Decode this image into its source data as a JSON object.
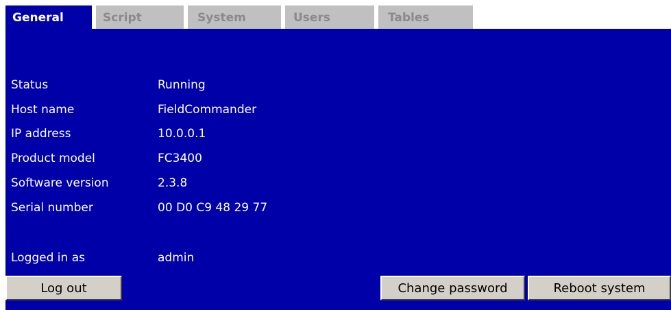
{
  "tabs": [
    {
      "label": "General",
      "active": true
    },
    {
      "label": "Script",
      "active": false
    },
    {
      "label": "System",
      "active": false
    },
    {
      "label": "Users",
      "active": false
    },
    {
      "label": "Tables",
      "active": false
    }
  ],
  "info": [
    {
      "label": "Status",
      "value": "Running"
    },
    {
      "label": "Host name",
      "value": "FieldCommander"
    },
    {
      "label": "IP address",
      "value": "10.0.0.1"
    },
    {
      "label": "Product model",
      "value": "FC3400"
    },
    {
      "label": "Software version",
      "value": "2.3.8"
    },
    {
      "label": "Serial number",
      "value": "00 D0 C9 48 29 77"
    }
  ],
  "login": {
    "label": "Logged in as",
    "value": "admin"
  },
  "buttons": {
    "logout": "Log out",
    "change_password": "Change password",
    "reboot": "Reboot system"
  },
  "colors": {
    "panel_bg": "#0000a8",
    "tab_inactive_bg": "#c0c0c0",
    "tab_inactive_text": "#8a8a8a",
    "button_bg": "#d4d0c8",
    "text": "#ffffff"
  }
}
